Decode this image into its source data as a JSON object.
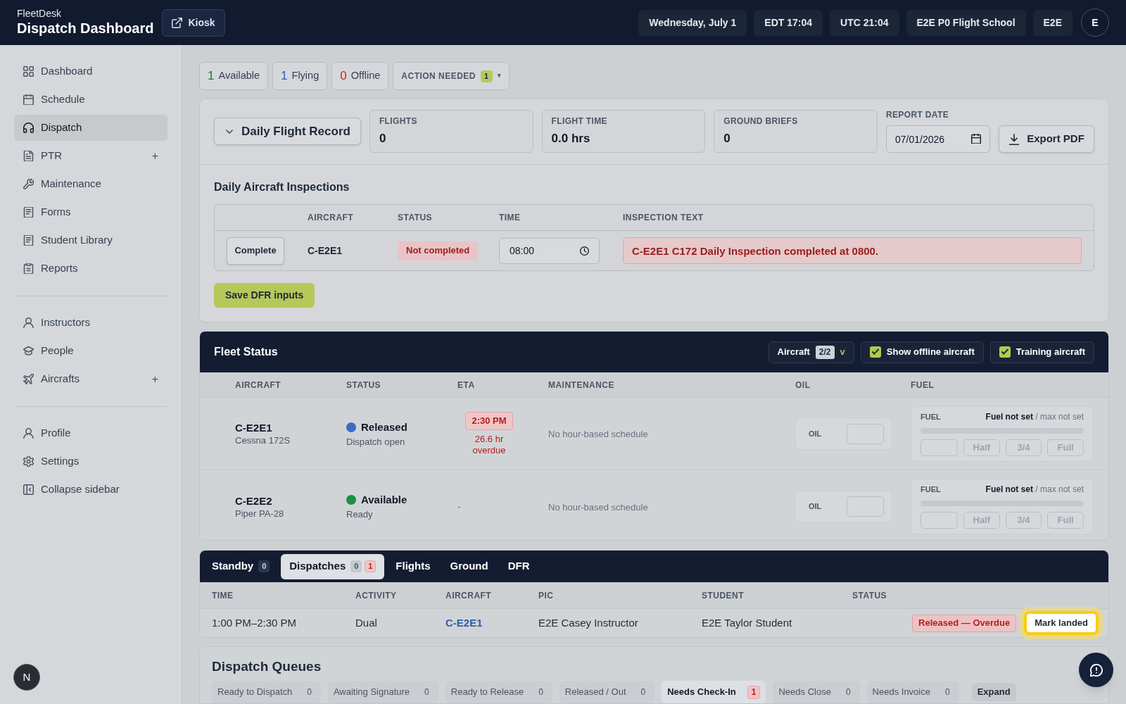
{
  "header": {
    "brand": "FleetDesk",
    "title": "Dispatch Dashboard",
    "kiosk_button": "Kiosk",
    "pills": [
      "Wednesday, July 1",
      "EDT 17:04",
      "UTC 21:04",
      "E2E P0 Flight School",
      "E2E"
    ],
    "avatar": "E"
  },
  "sidebar": {
    "sections": [
      {
        "items": [
          {
            "label": "Dashboard",
            "selected": false
          },
          {
            "label": "Schedule",
            "selected": false
          },
          {
            "label": "Dispatch",
            "selected": true
          },
          {
            "label": "PTR",
            "selected": false,
            "add": "+"
          },
          {
            "label": "Maintenance",
            "selected": false
          },
          {
            "label": "Forms",
            "selected": false
          },
          {
            "label": "Student Library",
            "selected": false
          },
          {
            "label": "Reports",
            "selected": false
          }
        ]
      },
      {
        "items": [
          {
            "label": "Instructors",
            "selected": false
          },
          {
            "label": "People",
            "selected": false
          },
          {
            "label": "Aircrafts",
            "selected": false,
            "add": "+"
          }
        ]
      },
      {
        "items": [
          {
            "label": "Profile",
            "selected": false
          },
          {
            "label": "Settings",
            "selected": false
          },
          {
            "label": "Collapse sidebar",
            "selected": false
          }
        ]
      }
    ],
    "dev_badge": "N"
  },
  "status_chips": [
    {
      "count": "1",
      "label": "Available",
      "color": "#1a7a3e"
    },
    {
      "count": "1",
      "label": "Flying",
      "color": "#2f5fb3"
    },
    {
      "count": "0",
      "label": "Offline",
      "color": "#c0262d"
    }
  ],
  "action_needed": {
    "label": "ACTION NEEDED",
    "count": "1",
    "caret": "▾"
  },
  "daily_flight_record": {
    "toggle": {
      "label": "Daily Flight Record",
      "expanded": true
    },
    "stats": [
      {
        "label": "FLIGHTS",
        "value": "0"
      },
      {
        "label": "FLIGHT TIME",
        "value": "0.0 hrs"
      },
      {
        "label": "GROUND BRIEFS",
        "value": "0"
      }
    ],
    "report_date": {
      "label": "REPORT DATE",
      "value": "07/01/2026"
    },
    "export_button": "Export PDF",
    "inspections": {
      "title": "Daily Aircraft Inspections",
      "columns": [
        "AIRCRAFT",
        "STATUS",
        "TIME",
        "INSPECTION TEXT"
      ],
      "rows": [
        {
          "action": "Complete",
          "aircraft": "C-E2E1",
          "status": "Not completed",
          "completed": false,
          "time": "08:00",
          "text": "C-E2E1 C172 Daily Inspection completed at 0800."
        }
      ]
    },
    "save_button": "Save DFR inputs"
  },
  "fleet_status": {
    "title": "Fleet Status",
    "aircraft_filter": {
      "label": "Aircraft",
      "count": "2/2",
      "caret": "v"
    },
    "toggles": [
      {
        "label": "Show offline aircraft",
        "checked": true
      },
      {
        "label": "Training aircraft",
        "checked": true
      }
    ],
    "columns": [
      "AIRCRAFT",
      "STATUS",
      "ETA",
      "MAINTENANCE",
      "OIL",
      "FUEL"
    ],
    "rows": [
      {
        "tail": "C-E2E1",
        "model": "Cessna 172S",
        "status": "Released",
        "status_detail": "Dispatch open",
        "color": "#3d6cc0",
        "eta": "2:30 PM",
        "eta_note": "26.6 hr overdue",
        "overdue": true,
        "maintenance": "No hour-based schedule",
        "oil_label": "OIL",
        "fuel": {
          "label": "FUEL",
          "reading": "Fuel not set",
          "max": "/ max not set",
          "buttons": [
            "Half",
            "3/4",
            "Full"
          ]
        }
      },
      {
        "tail": "C-E2E2",
        "model": "Piper PA-28",
        "status": "Available",
        "status_detail": "Ready",
        "color": "#1e8f46",
        "eta": "-",
        "overdue": false,
        "maintenance": "No hour-based schedule",
        "oil_label": "OIL",
        "fuel": {
          "label": "FUEL",
          "reading": "Fuel not set",
          "max": "/ max not set",
          "buttons": [
            "Half",
            "3/4",
            "Full"
          ]
        }
      }
    ]
  },
  "dispatch_panel": {
    "tabs": [
      {
        "label": "Standby",
        "selected": false,
        "counts": [
          {
            "value": "0",
            "alert": false
          }
        ]
      },
      {
        "label": "Dispatches",
        "selected": true,
        "counts": [
          {
            "value": "0",
            "alert": false
          },
          {
            "value": "1",
            "alert": true
          }
        ]
      },
      {
        "label": "Flights",
        "selected": false
      },
      {
        "label": "Ground",
        "selected": false
      },
      {
        "label": "DFR",
        "selected": false
      }
    ],
    "columns": [
      "TIME",
      "ACTIVITY",
      "AIRCRAFT",
      "PIC",
      "STUDENT",
      "STATUS"
    ],
    "rows": [
      {
        "time": "1:00 PM–2:30 PM",
        "activity": "Dual",
        "aircraft": "C-E2E1",
        "pic": "E2E Casey Instructor",
        "student": "E2E Taylor Student",
        "status": "Released — Overdue",
        "action": "Mark landed",
        "highlighted": true
      }
    ]
  },
  "dispatch_queues": {
    "title": "Dispatch Queues",
    "items": [
      {
        "label": "Ready to Dispatch",
        "count": "0",
        "selected": false,
        "alert": false
      },
      {
        "label": "Awaiting Signature",
        "count": "0",
        "selected": false,
        "alert": false
      },
      {
        "label": "Ready to Release",
        "count": "0",
        "selected": false,
        "alert": false
      },
      {
        "label": "Released / Out",
        "count": "0",
        "selected": false,
        "alert": false
      },
      {
        "label": "Needs Check-In",
        "count": "1",
        "selected": true,
        "alert": true
      },
      {
        "label": "Needs Close",
        "count": "0",
        "selected": false,
        "alert": false
      },
      {
        "label": "Needs Invoice",
        "count": "0",
        "selected": false,
        "alert": false
      }
    ],
    "expand_button": "Expand"
  }
}
